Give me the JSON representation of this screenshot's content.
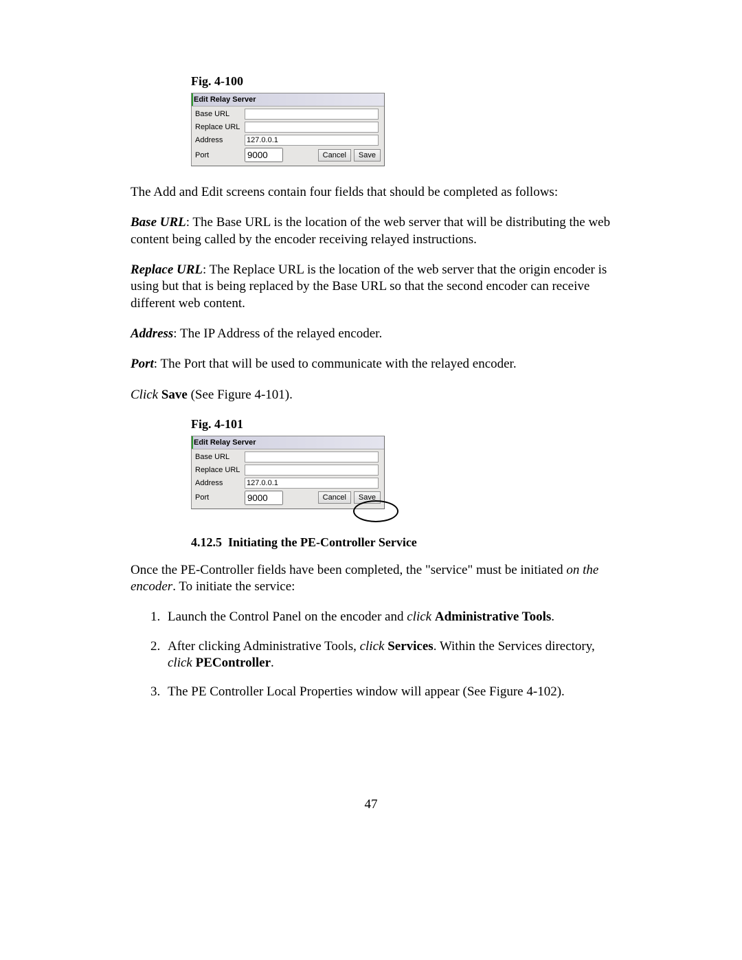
{
  "figures": {
    "f1": {
      "label": "Fig. 4-100",
      "title": "Edit Relay Server",
      "rows": {
        "base_url": {
          "label": "Base URL",
          "value": ""
        },
        "replace_url": {
          "label": "Replace URL",
          "value": ""
        },
        "address": {
          "label": "Address",
          "value": "127.0.0.1"
        },
        "port": {
          "label": "Port",
          "value": "9000"
        }
      },
      "buttons": {
        "cancel": "Cancel",
        "save": "Save"
      }
    },
    "f2": {
      "label": "Fig. 4-101",
      "title": "Edit Relay Server",
      "rows": {
        "base_url": {
          "label": "Base URL",
          "value": ""
        },
        "replace_url": {
          "label": "Replace URL",
          "value": ""
        },
        "address": {
          "label": "Address",
          "value": "127.0.0.1"
        },
        "port": {
          "label": "Port",
          "value": "9000"
        }
      },
      "buttons": {
        "cancel": "Cancel",
        "save": "Save"
      }
    }
  },
  "paragraphs": {
    "intro": "The Add and Edit screens contain four fields that should be completed as follows:",
    "base_url_label": "Base URL",
    "base_url_text": ":  The Base URL is the location of the web server that will be distributing the web content being called by the encoder receiving relayed instructions.",
    "replace_url_label": "Replace URL",
    "replace_url_text": ":  The Replace URL is the location of the web server that the origin encoder is using but that is being replaced by the Base URL so that the second encoder can receive different web content.",
    "address_label": "Address",
    "address_text": ":  The IP Address of the relayed encoder.",
    "port_label": "Port",
    "port_text": ":  The Port that will be used to communicate with the relayed encoder.",
    "click_word": "Click",
    "save_word": "Save",
    "save_tail": " (See Figure 4-101)."
  },
  "section": {
    "number": "4.12.5",
    "title": "Initiating the PE-Controller Service",
    "lead1": "Once the PE-Controller fields have been completed, the \"service\" must be initiated ",
    "lead_em": "on the encoder",
    "lead2": ".  To initiate the service:"
  },
  "steps": {
    "s1_a": "Launch the Control Panel on the encoder and ",
    "s1_click": "click",
    "s1_bold": "Administrative Tools",
    "s1_c": ".",
    "s2_a": "After clicking Administrative Tools, ",
    "s2_click": "click",
    "s2_bold": "Services",
    "s2_mid": ".  Within the Services directory, ",
    "s2_click2": "click",
    "s2_bold2": "PEController",
    "s2_c": ".",
    "s3": "The PE Controller Local Properties window will appear (See Figure 4-102)."
  },
  "page_number": "47"
}
